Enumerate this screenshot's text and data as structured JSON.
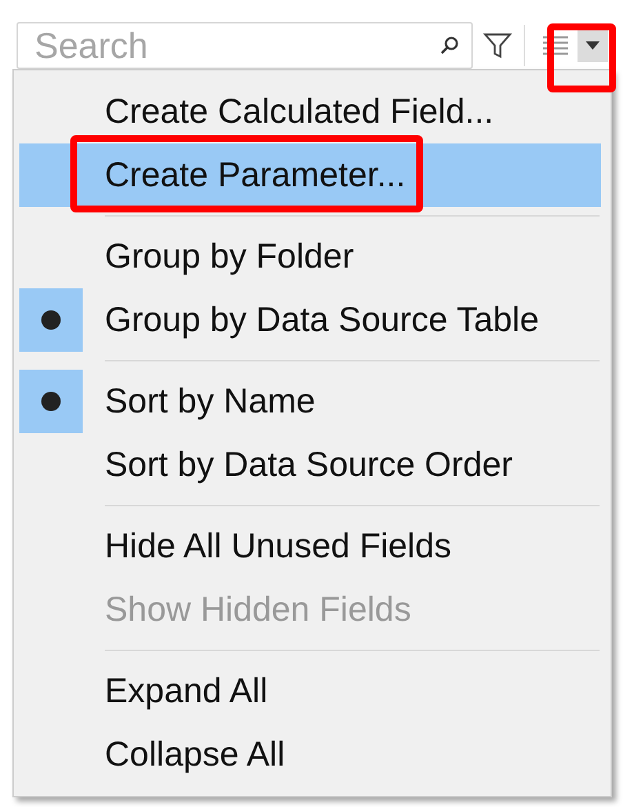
{
  "search": {
    "placeholder": "Search"
  },
  "view_button": {
    "annotated": true
  },
  "menu": {
    "items": [
      {
        "kind": "item",
        "label": "Create Calculated Field...",
        "selected": false,
        "checked": false,
        "disabled": false,
        "annotated": false
      },
      {
        "kind": "item",
        "label": "Create Parameter...",
        "selected": true,
        "checked": false,
        "disabled": false,
        "annotated": true
      },
      {
        "kind": "separator"
      },
      {
        "kind": "item",
        "label": "Group by Folder",
        "selected": false,
        "checked": false,
        "disabled": false,
        "annotated": false
      },
      {
        "kind": "item",
        "label": "Group by Data Source Table",
        "selected": false,
        "checked": true,
        "disabled": false,
        "annotated": false
      },
      {
        "kind": "separator"
      },
      {
        "kind": "item",
        "label": "Sort by Name",
        "selected": false,
        "checked": true,
        "disabled": false,
        "annotated": false
      },
      {
        "kind": "item",
        "label": "Sort by Data Source Order",
        "selected": false,
        "checked": false,
        "disabled": false,
        "annotated": false
      },
      {
        "kind": "separator"
      },
      {
        "kind": "item",
        "label": "Hide All Unused Fields",
        "selected": false,
        "checked": false,
        "disabled": false,
        "annotated": false
      },
      {
        "kind": "item",
        "label": "Show Hidden Fields",
        "selected": false,
        "checked": false,
        "disabled": true,
        "annotated": false
      },
      {
        "kind": "separator"
      },
      {
        "kind": "item",
        "label": "Expand All",
        "selected": false,
        "checked": false,
        "disabled": false,
        "annotated": false
      },
      {
        "kind": "item",
        "label": "Collapse All",
        "selected": false,
        "checked": false,
        "disabled": false,
        "annotated": false
      }
    ]
  }
}
